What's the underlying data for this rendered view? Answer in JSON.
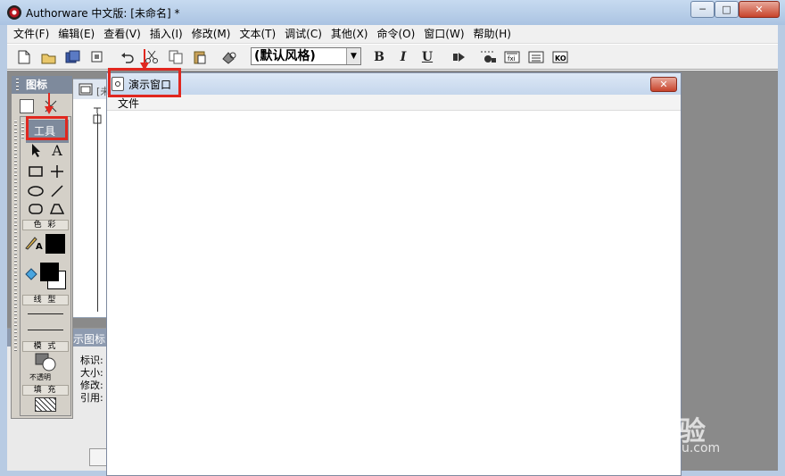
{
  "window": {
    "title": "Authorware 中文版: [未命名] *",
    "min_label": "─",
    "max_label": "□",
    "close_label": "✕"
  },
  "menubar": {
    "items": [
      {
        "label": "文件(F)"
      },
      {
        "label": "编辑(E)"
      },
      {
        "label": "查看(V)"
      },
      {
        "label": "插入(I)"
      },
      {
        "label": "修改(M)"
      },
      {
        "label": "文本(T)"
      },
      {
        "label": "调试(C)"
      },
      {
        "label": "其他(X)"
      },
      {
        "label": "命令(O)"
      },
      {
        "label": "窗口(W)"
      },
      {
        "label": "帮助(H)"
      }
    ]
  },
  "toolbar": {
    "font_style_value": "(默认风格)",
    "bold_label": "B",
    "italic_label": "I",
    "underline_label": "U"
  },
  "icon_palette": {
    "title": "图标"
  },
  "tools_panel": {
    "title": "工具",
    "color_section": "色 彩",
    "line_section": "线 型",
    "mode_section": "模 式",
    "mode_value": "不透明",
    "fill_section": "填 充"
  },
  "design_window": {
    "label_partial": "[未"
  },
  "properties_panel": {
    "title_partial": "示图标",
    "labels": [
      "标识:",
      "大小:",
      "修改:",
      "引用:"
    ]
  },
  "presentation_window": {
    "title": "演示窗口",
    "menu_file": "文件",
    "close_label": "✕"
  },
  "watermark": {
    "text": "Bai 经验",
    "sub": "jingyan.baidu.com"
  },
  "colors": {
    "highlight": "#e0271f",
    "title_gradient_top": "#c7daf0",
    "workspace": "#8a8a8a"
  }
}
